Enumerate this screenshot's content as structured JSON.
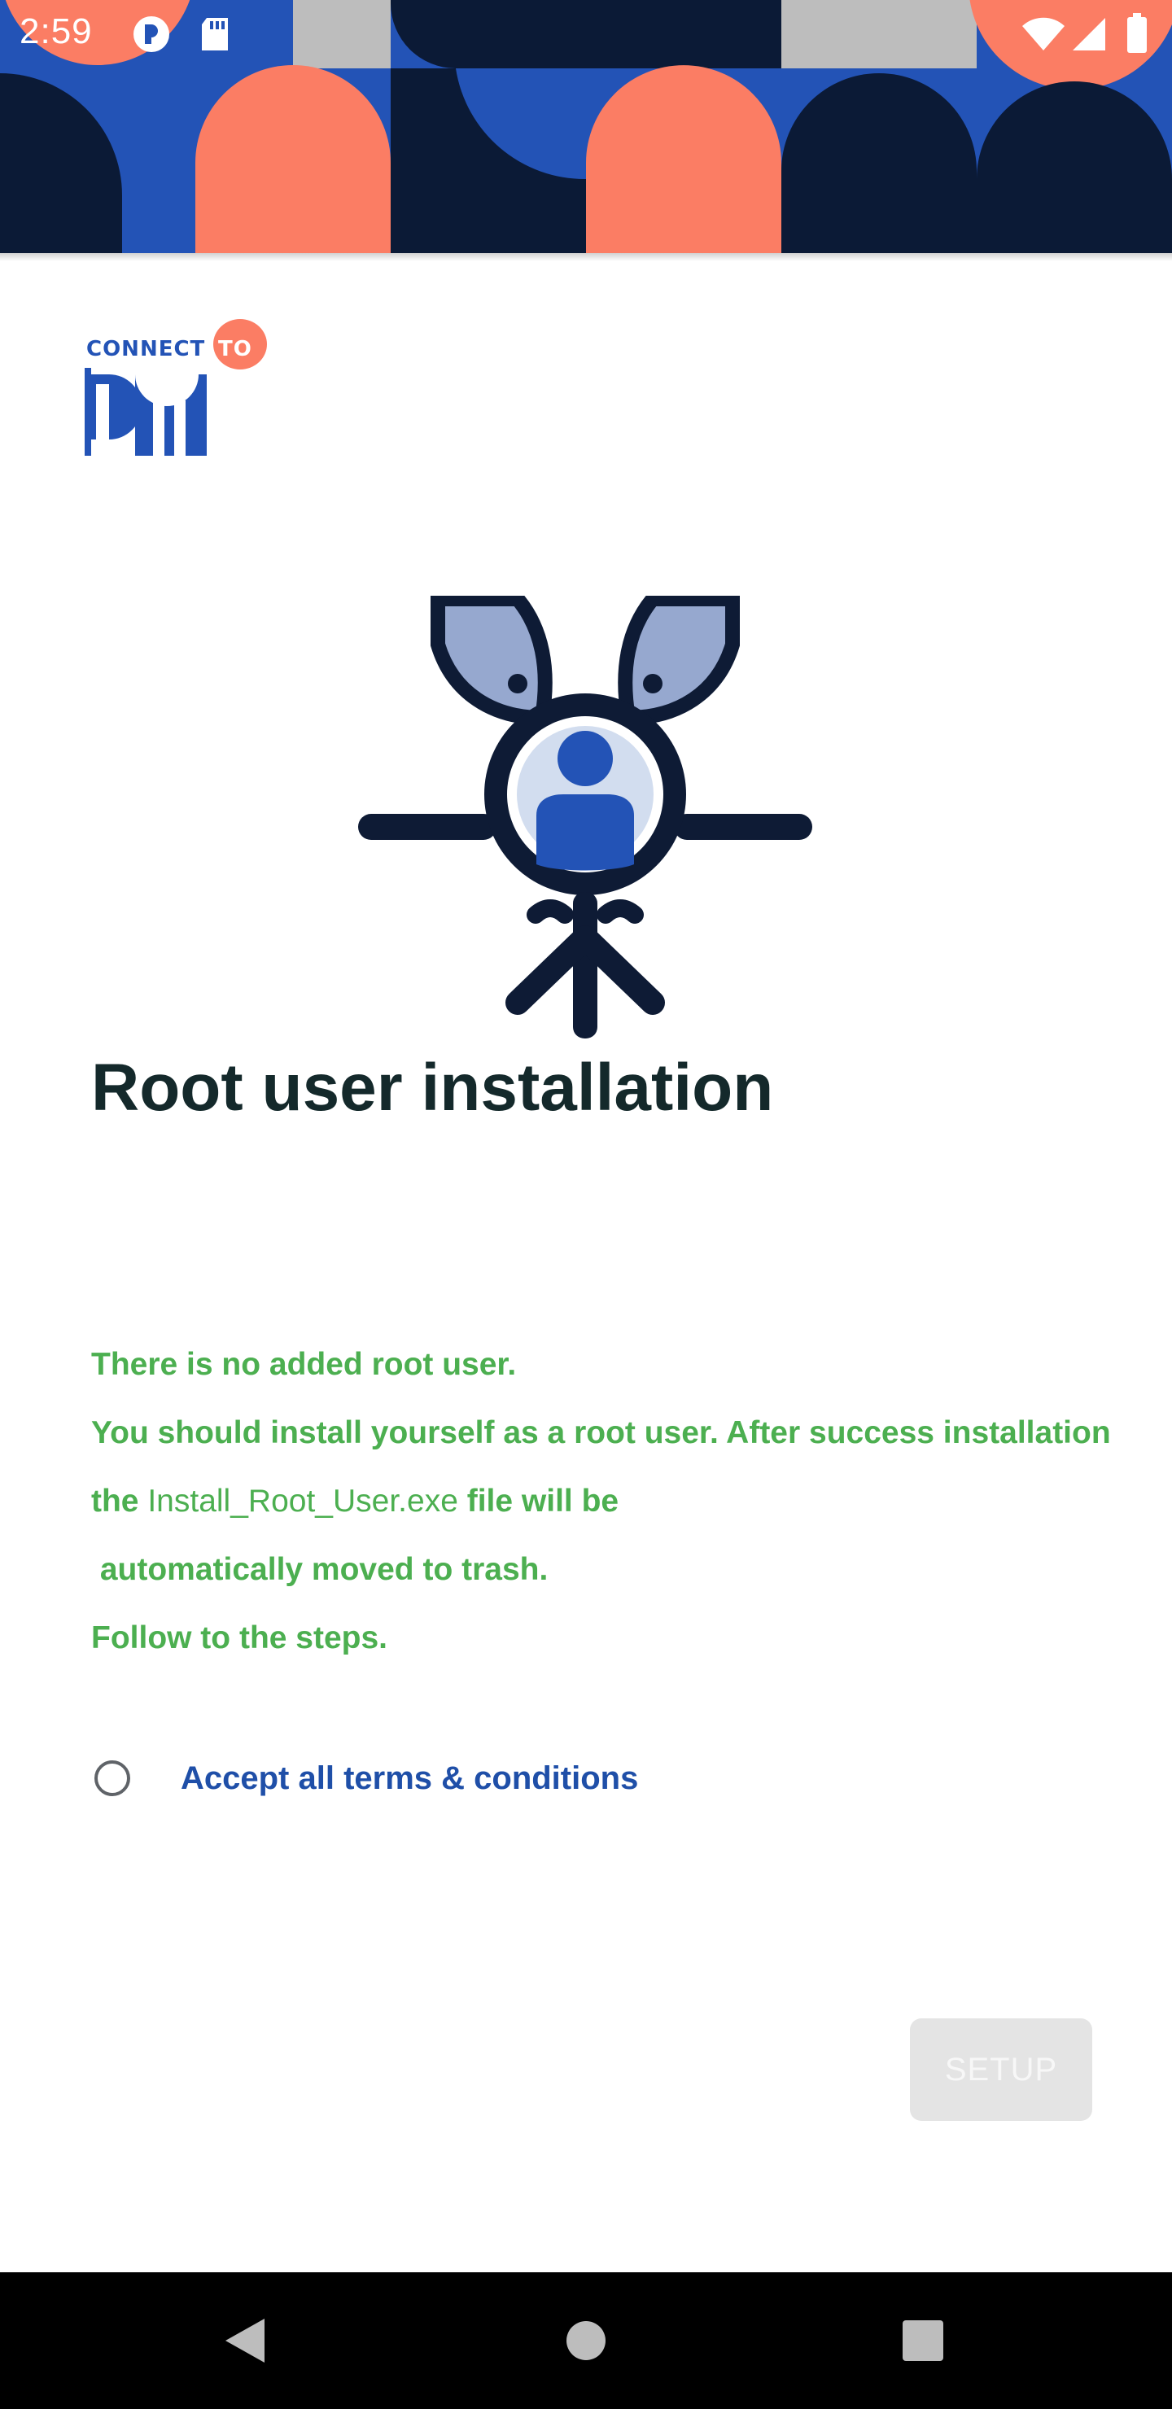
{
  "status_bar": {
    "time": "2:59",
    "icons": [
      "app-notification-icon",
      "sd-card-icon",
      "wifi-icon",
      "signal-icon",
      "battery-icon"
    ]
  },
  "banner": {
    "colors": {
      "blue": "#2353b6",
      "navy": "#0b1a36",
      "coral": "#fb7d64",
      "grey": "#bdbdbd"
    }
  },
  "logo": {
    "text": "CONNECT",
    "badge": "TO"
  },
  "illustration": {
    "icon": "root-user-tree-icon"
  },
  "page": {
    "title": "Root user installation",
    "message": {
      "line1": "There is no added root user.",
      "line2": "You should install yourself as a root user. After success installation",
      "line3_prefix": "the ",
      "line3_file": "Install_Root_User.exe",
      "line3_suffix": " file will be",
      "line4": " automatically moved to trash.",
      "line5": "Follow to the steps."
    },
    "terms_label": "Accept all terms & conditions",
    "terms_checked": false,
    "setup_label": "SETUP"
  },
  "colors": {
    "title": "#14292b",
    "message": "#4caf50",
    "terms": "#1f4fa8",
    "button_disabled": "#e4e4e4"
  },
  "nav_bar": {
    "buttons": [
      "back-icon",
      "home-icon",
      "recents-icon"
    ]
  }
}
